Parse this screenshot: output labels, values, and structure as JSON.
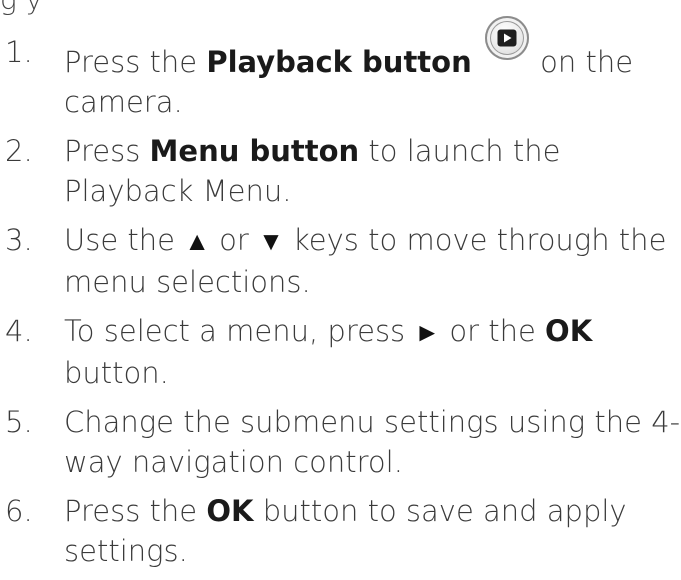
{
  "header_fragment": "g    y",
  "steps": [
    {
      "num": "1.",
      "pre": "Press the ",
      "bold": "Playback button",
      "post_a": " on the",
      "post_b": "camera.",
      "icon": "playback-button-icon"
    },
    {
      "num": "2.",
      "pre": "Press ",
      "bold": "Menu button",
      "post": " to launch the Playback Menu."
    },
    {
      "num": "3.",
      "a": "Use the ",
      "up_glyph": "▲",
      "b": " or ",
      "down_glyph": "▼",
      "c": " keys to move through the menu selections."
    },
    {
      "num": "4.",
      "a": "To select a menu, press ",
      "right_glyph": "►",
      "b": " or the ",
      "bold": "OK",
      "c": " button."
    },
    {
      "num": "5.",
      "text": "Change the submenu settings using the 4-way navigation control."
    },
    {
      "num": "6.",
      "a": "Press the ",
      "bold": "OK",
      "b": " button to save and apply settings."
    }
  ]
}
